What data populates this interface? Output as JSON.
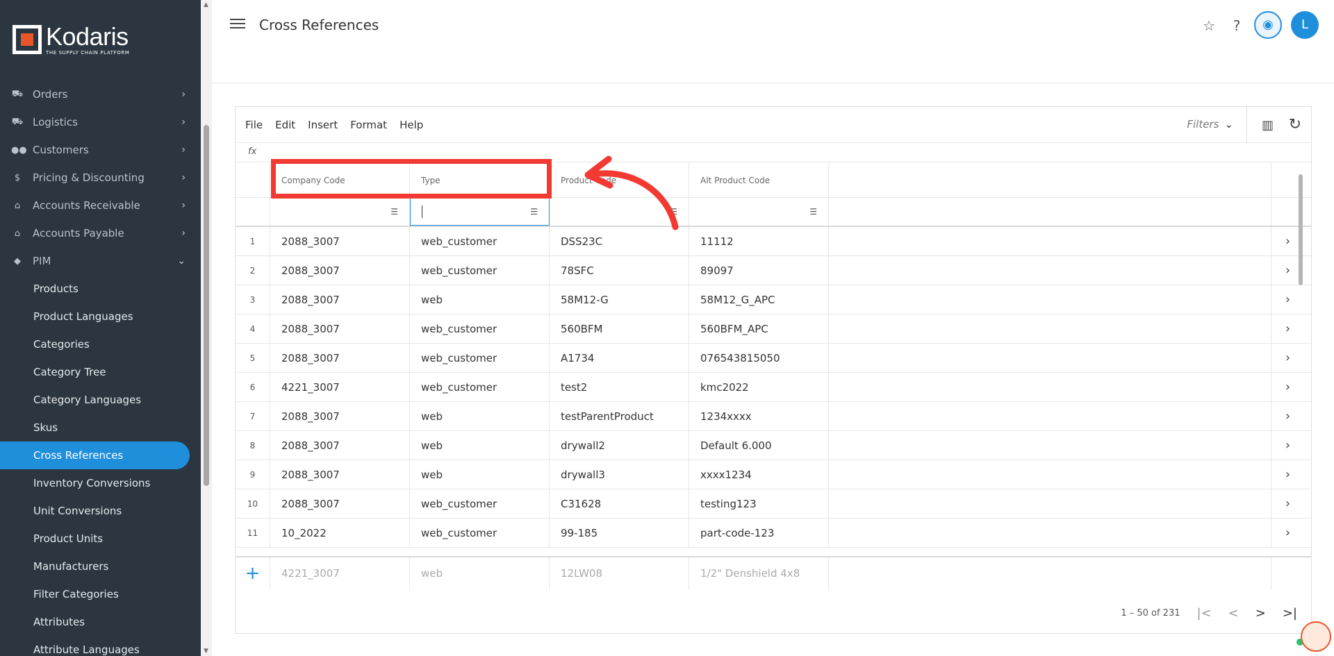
{
  "brand": {
    "name": "Kodaris",
    "tagline": "THE SUPPLY CHAIN PLATFORM"
  },
  "sidebar": {
    "sections": [
      {
        "label": "Orders",
        "icon": "truck-icon"
      },
      {
        "label": "Logistics",
        "icon": "delivery-icon"
      },
      {
        "label": "Customers",
        "icon": "people-icon"
      },
      {
        "label": "Pricing & Discounting",
        "icon": "dollar-icon"
      },
      {
        "label": "Accounts Receivable",
        "icon": "bank-icon"
      },
      {
        "label": "Accounts Payable",
        "icon": "bank-icon"
      },
      {
        "label": "PIM",
        "icon": "tag-icon"
      }
    ],
    "pim_items": [
      "Products",
      "Product Languages",
      "Categories",
      "Category Tree",
      "Category Languages",
      "Skus",
      "Cross References",
      "Inventory Conversions",
      "Unit Conversions",
      "Product Units",
      "Manufacturers",
      "Filter Categories",
      "Attributes",
      "Attribute Languages"
    ],
    "active_item": "Cross References"
  },
  "header": {
    "title": "Cross References",
    "avatar_initial": "L"
  },
  "toolbar": {
    "menus": [
      "File",
      "Edit",
      "Insert",
      "Format",
      "Help"
    ],
    "filters_label": "Filters",
    "fx_label": "fx"
  },
  "grid": {
    "columns": [
      "Company Code",
      "Type",
      "Product Code",
      "Alt Product Code"
    ],
    "rows": [
      [
        "1",
        "2088_3007",
        "web_customer",
        "DSS23C",
        "11112"
      ],
      [
        "2",
        "2088_3007",
        "web_customer",
        "78SFC",
        "89097"
      ],
      [
        "3",
        "2088_3007",
        "web",
        "58M12-G",
        "58M12_G_APC"
      ],
      [
        "4",
        "2088_3007",
        "web_customer",
        "560BFM",
        "560BFM_APC"
      ],
      [
        "5",
        "2088_3007",
        "web_customer",
        "A1734",
        "076543815050"
      ],
      [
        "6",
        "4221_3007",
        "web_customer",
        "test2",
        "kmc2022"
      ],
      [
        "7",
        "2088_3007",
        "web",
        "testParentProduct",
        "1234xxxx"
      ],
      [
        "8",
        "2088_3007",
        "web",
        "drywall2",
        "Default 6.000"
      ],
      [
        "9",
        "2088_3007",
        "web",
        "drywall3",
        "xxxx1234"
      ],
      [
        "10",
        "2088_3007",
        "web_customer",
        "C31628",
        "testing123"
      ],
      [
        "11",
        "10_2022",
        "web_customer",
        "99-185",
        "part-code-123"
      ]
    ],
    "new_row": [
      "4221_3007",
      "web",
      "12LW08",
      "1/2\" Denshield 4x8"
    ],
    "new_row_symbol": "+"
  },
  "pagination": {
    "range": "1 – 50 of 231"
  }
}
